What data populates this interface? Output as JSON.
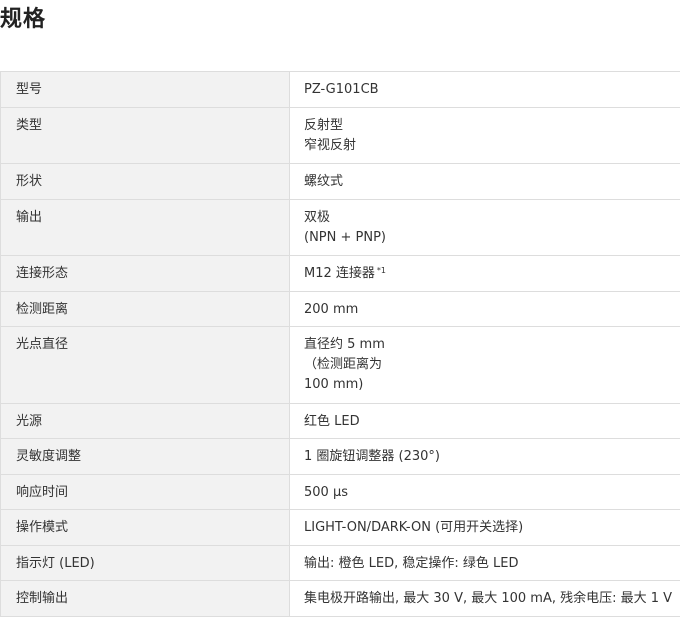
{
  "page": {
    "title": "规格"
  },
  "specs": {
    "rows": [
      {
        "label": "型号",
        "lines": [
          "PZ-G101CB"
        ]
      },
      {
        "label": "类型",
        "lines": [
          "反射型",
          "窄视反射"
        ]
      },
      {
        "label": "形状",
        "lines": [
          "螺纹式"
        ]
      },
      {
        "label": "输出",
        "lines": [
          "双极",
          "(NPN + PNP)"
        ]
      },
      {
        "label": "连接形态",
        "lines": [
          "M12 连接器"
        ],
        "note": "*1"
      },
      {
        "label": "检测距离",
        "lines": [
          "200 mm"
        ]
      },
      {
        "label": "光点直径",
        "lines": [
          "直径约 5 mm",
          "（检测距离为",
          "100 mm)"
        ]
      },
      {
        "label": "光源",
        "lines": [
          "红色 LED"
        ]
      },
      {
        "label": "灵敏度调整",
        "lines": [
          "1 圈旋钮调整器 (230°)"
        ]
      },
      {
        "label": "响应时间",
        "lines": [
          "500 µs"
        ]
      },
      {
        "label": "操作模式",
        "lines": [
          "LIGHT-ON/DARK-ON (可用开关选择)"
        ]
      },
      {
        "label": "指示灯 (LED)",
        "lines": [
          "输出: 橙色 LED, 稳定操作: 绿色 LED"
        ]
      },
      {
        "label": "控制输出",
        "lines": [
          "集电极开路输出, 最大 30 V, 最大 100 mA, 残余电压: 最大 1 V"
        ]
      }
    ]
  }
}
